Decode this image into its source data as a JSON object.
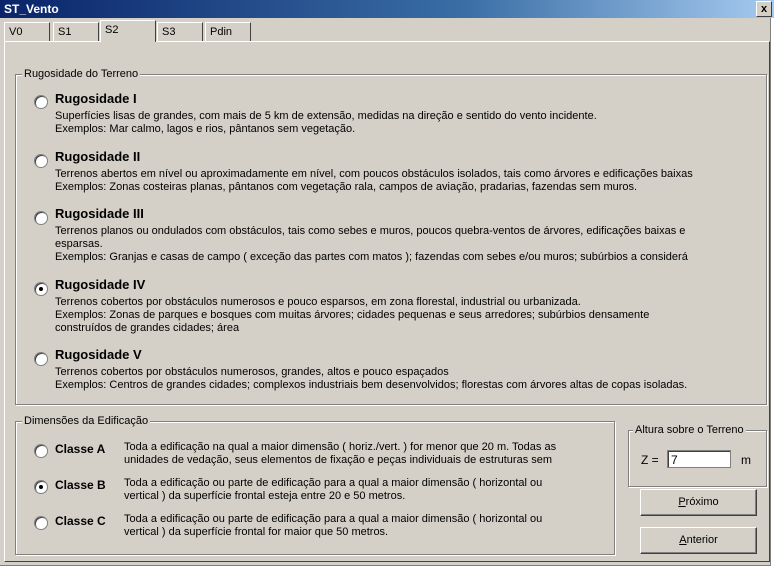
{
  "window": {
    "title": "ST_Vento",
    "close_label": "x"
  },
  "tabs": [
    {
      "label": "V0"
    },
    {
      "label": "S1"
    },
    {
      "label": "S2",
      "active": true
    },
    {
      "label": "S3"
    },
    {
      "label": "Pdin"
    }
  ],
  "rugosidade": {
    "legend": "Rugosidade do Terreno",
    "selected": "Rugosidade IV",
    "options": [
      {
        "title": "Rugosidade I",
        "lines": [
          "Superfícies lisas de grandes, com mais de 5 km de extensão, medidas na direção e sentido do vento incidente.",
          "Exemplos: Mar calmo, lagos e rios, pântanos sem vegetação."
        ]
      },
      {
        "title": "Rugosidade II",
        "lines": [
          "Terrenos abertos em nível ou aproximadamente em nível, com poucos obstáculos isolados, tais como árvores e edificações baixas",
          "Exemplos: Zonas costeiras planas, pântanos com vegetação rala, campos de aviação, pradarias, fazendas sem muros."
        ]
      },
      {
        "title": "Rugosidade III",
        "lines": [
          "Terrenos planos ou ondulados com obstáculos, tais como sebes e muros, poucos quebra-ventos de árvores, edificações baixas e",
          "esparsas.",
          "Exemplos: Granjas e casas de campo ( exceção das partes com matos ); fazendas com sebes e/ou muros; subúrbios a considerá"
        ]
      },
      {
        "title": "Rugosidade IV",
        "lines": [
          "Terrenos cobertos por obstáculos numerosos e pouco esparsos, em zona florestal, industrial ou urbanizada.",
          "Exemplos: Zonas de parques e bosques com muitas árvores; cidades pequenas e seus arredores; subúrbios densamente",
          "construídos de grandes cidades; área"
        ]
      },
      {
        "title": "Rugosidade V",
        "lines": [
          "Terrenos cobertos por obstáculos numerosos, grandes, altos e pouco espaçados",
          "Exemplos: Centros de grandes cidades; complexos industriais bem desenvolvidos; florestas com árvores altas de copas isoladas."
        ]
      }
    ]
  },
  "dimensoes": {
    "legend": "Dimensões da Edificação",
    "selected": "Classe B",
    "options": [
      {
        "title": "Classe A",
        "lines": [
          "Toda a edificação na qual a maior dimensão ( horiz./vert. ) for menor que 20 m. Todas as",
          "unidades de vedação, seus elementos de fixação e peças individuais de estruturas sem"
        ]
      },
      {
        "title": "Classe B",
        "lines": [
          "Toda a edificação ou parte de edificação para a qual a maior dimensão ( horizontal ou",
          "vertical ) da superfície frontal esteja entre 20 e 50 metros."
        ]
      },
      {
        "title": "Classe C",
        "lines": [
          "Toda a edificação ou parte de edificação para a qual a maior dimensão ( horizontal ou",
          "vertical ) da superfície frontal for maior que 50 metros."
        ]
      }
    ]
  },
  "altura": {
    "legend": "Altura sobre o Terreno",
    "z_label": "Z =",
    "z_value": "7",
    "unit": "m"
  },
  "buttons": {
    "next_prefix": "",
    "next_accel": "P",
    "next_rest": "róximo",
    "prev_prefix": "",
    "prev_accel": "A",
    "prev_rest": "nterior"
  }
}
